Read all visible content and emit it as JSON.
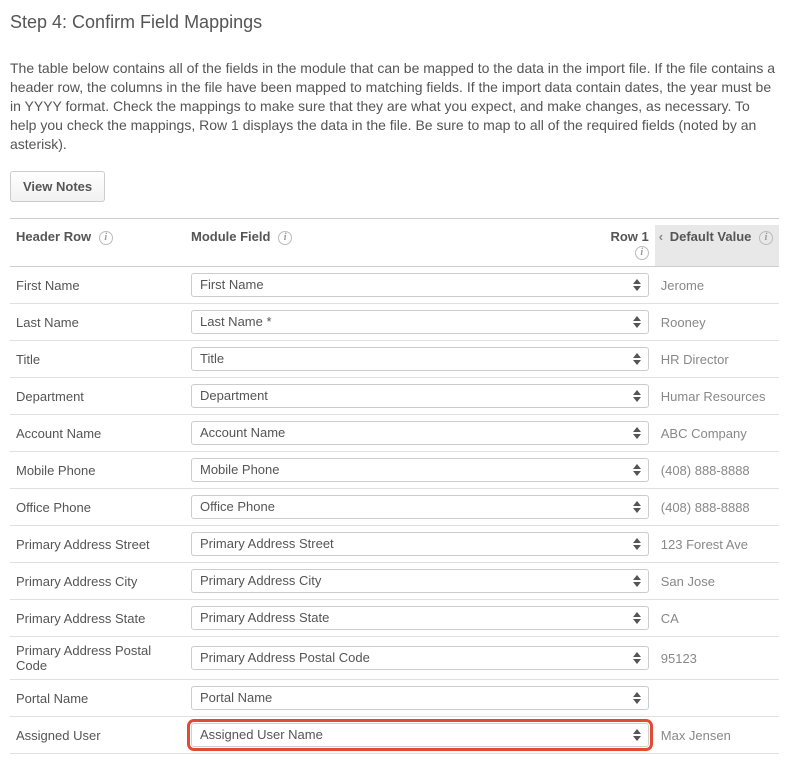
{
  "title": "Step 4: Confirm Field Mappings",
  "intro": "The table below contains all of the fields in the module that can be mapped to the data in the import file. If the file contains a header row, the columns in the file have been mapped to matching fields. If the import data contain dates, the year must be in YYYY format. Check the mappings to make sure that they are what you expect, and make changes, as necessary. To help you check the mappings, Row 1 displays the data in the file. Be sure to map to all of the required fields (noted by an asterisk).",
  "buttons": {
    "view_notes": "View Notes"
  },
  "columns": {
    "header_row": "Header Row",
    "module_field": "Module Field",
    "row1": "Row 1",
    "default_value": "Default Value"
  },
  "rows": [
    {
      "header": "First Name",
      "module": "First Name",
      "row1": "Jerome",
      "highlight": false
    },
    {
      "header": "Last Name",
      "module": "Last Name *",
      "row1": "Rooney",
      "highlight": false
    },
    {
      "header": "Title",
      "module": "Title",
      "row1": "HR Director",
      "highlight": false
    },
    {
      "header": "Department",
      "module": "Department",
      "row1": "Humar Resources",
      "highlight": false
    },
    {
      "header": "Account Name",
      "module": "Account Name",
      "row1": "ABC Company",
      "highlight": false
    },
    {
      "header": "Mobile Phone",
      "module": "Mobile Phone",
      "row1": "(408) 888-8888",
      "highlight": false
    },
    {
      "header": "Office Phone",
      "module": "Office Phone",
      "row1": "(408) 888-8888",
      "highlight": false
    },
    {
      "header": "Primary Address Street",
      "module": "Primary Address Street",
      "row1": "123 Forest Ave",
      "highlight": false
    },
    {
      "header": "Primary Address City",
      "module": "Primary Address City",
      "row1": "San Jose",
      "highlight": false
    },
    {
      "header": "Primary Address State",
      "module": "Primary Address State",
      "row1": "CA",
      "highlight": false
    },
    {
      "header": "Primary Address Postal Code",
      "module": "Primary Address Postal Code",
      "row1": "95123",
      "highlight": false
    },
    {
      "header": "Portal Name",
      "module": "Portal Name",
      "row1": "",
      "highlight": false
    },
    {
      "header": "Assigned User",
      "module": "Assigned User Name",
      "row1": "Max Jensen",
      "highlight": true
    }
  ]
}
